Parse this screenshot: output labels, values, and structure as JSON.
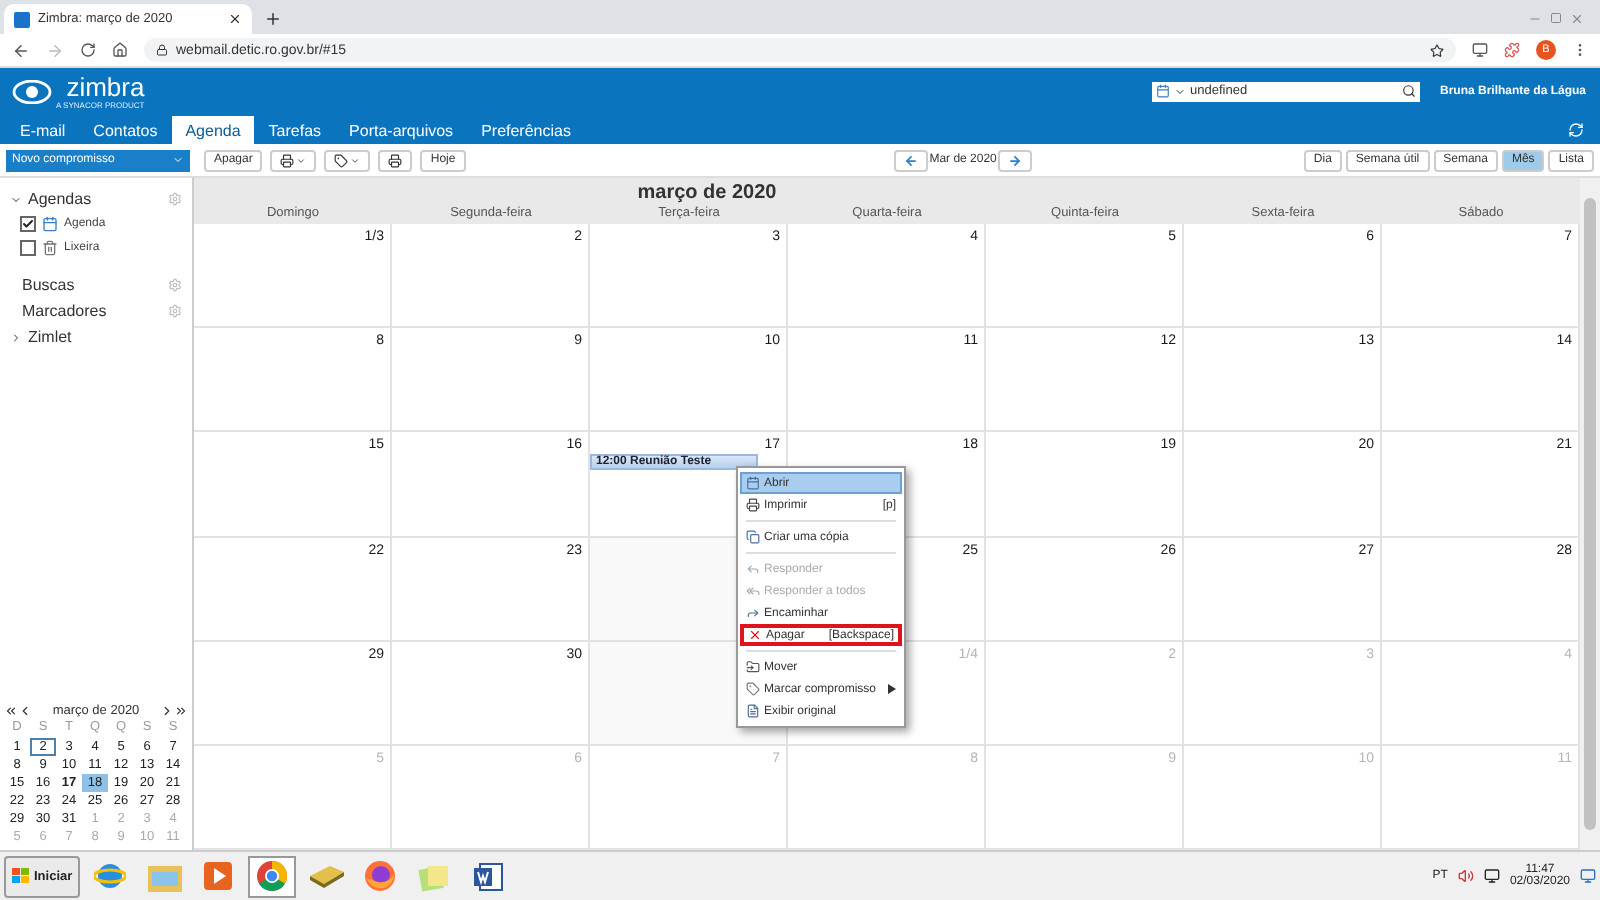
{
  "browser": {
    "tab_title": "Zimbra: março de 2020",
    "url": "webmail.detic.ro.gov.br/#15",
    "avatar": "B"
  },
  "header": {
    "logo": "zimbra",
    "logo_tagline": "A SYNACOR PRODUCT",
    "search": {
      "value": "undefined"
    },
    "user": "Bruna Brilhante da Lágua"
  },
  "tabs": [
    {
      "label": "E-mail",
      "selected": false
    },
    {
      "label": "Contatos",
      "selected": false
    },
    {
      "label": "Agenda",
      "selected": true
    },
    {
      "label": "Tarefas",
      "selected": false
    },
    {
      "label": "Porta-arquivos",
      "selected": false
    },
    {
      "label": "Preferências",
      "selected": false
    }
  ],
  "toolbar": {
    "new": "Novo compromisso",
    "delete": "Apagar",
    "today": "Hoje",
    "period": "Mar de 2020",
    "views": [
      {
        "label": "Dia",
        "selected": false
      },
      {
        "label": "Semana útil",
        "selected": false
      },
      {
        "label": "Semana",
        "selected": false
      },
      {
        "label": "Mês",
        "selected": true
      },
      {
        "label": "Lista",
        "selected": false
      }
    ]
  },
  "sidebar": {
    "agendas": {
      "label": "Agendas",
      "expanded": true,
      "items": [
        {
          "label": "Agenda",
          "checked": true,
          "kind": "calendar"
        },
        {
          "label": "Lixeira",
          "checked": false,
          "kind": "trash"
        }
      ]
    },
    "sections": [
      {
        "label": "Buscas"
      },
      {
        "label": "Marcadores"
      }
    ],
    "zimlet": {
      "label": "Zimlet",
      "expanded": false
    }
  },
  "mini_calendar": {
    "title": "março de 2020",
    "weekdays": [
      "D",
      "S",
      "T",
      "Q",
      "Q",
      "S",
      "S"
    ],
    "weeks": [
      [
        {
          "d": "1",
          "selected": false,
          "today": false,
          "has_events": false,
          "other_month": false
        },
        {
          "d": "2",
          "selected": false,
          "today": true,
          "has_events": false,
          "other_month": false
        },
        {
          "d": "3",
          "selected": false,
          "today": false,
          "has_events": false,
          "other_month": false
        },
        {
          "d": "4",
          "selected": false,
          "today": false,
          "has_events": false,
          "other_month": false
        },
        {
          "d": "5",
          "selected": false,
          "today": false,
          "has_events": false,
          "other_month": false
        },
        {
          "d": "6",
          "selected": false,
          "today": false,
          "has_events": false,
          "other_month": false
        },
        {
          "d": "7",
          "selected": false,
          "today": false,
          "has_events": false,
          "other_month": false
        }
      ],
      [
        {
          "d": "8",
          "selected": false,
          "today": false,
          "has_events": false,
          "other_month": false
        },
        {
          "d": "9",
          "selected": false,
          "today": false,
          "has_events": false,
          "other_month": false
        },
        {
          "d": "10",
          "selected": false,
          "today": false,
          "has_events": false,
          "other_month": false
        },
        {
          "d": "11",
          "selected": false,
          "today": false,
          "has_events": false,
          "other_month": false
        },
        {
          "d": "12",
          "selected": false,
          "today": false,
          "has_events": false,
          "other_month": false
        },
        {
          "d": "13",
          "selected": false,
          "today": false,
          "has_events": false,
          "other_month": false
        },
        {
          "d": "14",
          "selected": false,
          "today": false,
          "has_events": false,
          "other_month": false
        }
      ],
      [
        {
          "d": "15",
          "selected": false,
          "today": false,
          "has_events": false,
          "other_month": false
        },
        {
          "d": "16",
          "selected": false,
          "today": false,
          "has_events": false,
          "other_month": false
        },
        {
          "d": "17",
          "selected": false,
          "today": false,
          "has_events": true,
          "other_month": false
        },
        {
          "d": "18",
          "selected": true,
          "today": false,
          "has_events": false,
          "other_month": false
        },
        {
          "d": "19",
          "selected": false,
          "today": false,
          "has_events": false,
          "other_month": false
        },
        {
          "d": "20",
          "selected": false,
          "today": false,
          "has_events": false,
          "other_month": false
        },
        {
          "d": "21",
          "selected": false,
          "today": false,
          "has_events": false,
          "other_month": false
        }
      ],
      [
        {
          "d": "22",
          "selected": false,
          "today": false,
          "has_events": false,
          "other_month": false
        },
        {
          "d": "23",
          "selected": false,
          "today": false,
          "has_events": false,
          "other_month": false
        },
        {
          "d": "24",
          "selected": false,
          "today": false,
          "has_events": false,
          "other_month": false
        },
        {
          "d": "25",
          "selected": false,
          "today": false,
          "has_events": false,
          "other_month": false
        },
        {
          "d": "26",
          "selected": false,
          "today": false,
          "has_events": false,
          "other_month": false
        },
        {
          "d": "27",
          "selected": false,
          "today": false,
          "has_events": false,
          "other_month": false
        },
        {
          "d": "28",
          "selected": false,
          "today": false,
          "has_events": false,
          "other_month": false
        }
      ],
      [
        {
          "d": "29",
          "selected": false,
          "today": false,
          "has_events": false,
          "other_month": false
        },
        {
          "d": "30",
          "selected": false,
          "today": false,
          "has_events": false,
          "other_month": false
        },
        {
          "d": "31",
          "selected": false,
          "today": false,
          "has_events": false,
          "other_month": false
        },
        {
          "d": "1",
          "selected": false,
          "today": false,
          "has_events": false,
          "other_month": true
        },
        {
          "d": "2",
          "selected": false,
          "today": false,
          "has_events": false,
          "other_month": true
        },
        {
          "d": "3",
          "selected": false,
          "today": false,
          "has_events": false,
          "other_month": true
        },
        {
          "d": "4",
          "selected": false,
          "today": false,
          "has_events": false,
          "other_month": true
        }
      ],
      [
        {
          "d": "5",
          "selected": false,
          "today": false,
          "has_events": false,
          "other_month": true
        },
        {
          "d": "6",
          "selected": false,
          "today": false,
          "has_events": false,
          "other_month": true
        },
        {
          "d": "7",
          "selected": false,
          "today": false,
          "has_events": false,
          "other_month": true
        },
        {
          "d": "8",
          "selected": false,
          "today": false,
          "has_events": false,
          "other_month": true
        },
        {
          "d": "9",
          "selected": false,
          "today": false,
          "has_events": false,
          "other_month": true
        },
        {
          "d": "10",
          "selected": false,
          "today": false,
          "has_events": false,
          "other_month": true
        },
        {
          "d": "11",
          "selected": false,
          "today": false,
          "has_events": false,
          "other_month": true
        }
      ]
    ]
  },
  "calendar": {
    "title": "março de 2020",
    "weekdays": [
      "Domingo",
      "Segunda-feira",
      "Terça-feira",
      "Quarta-feira",
      "Quinta-feira",
      "Sexta-feira",
      "Sábado"
    ],
    "weeks": [
      [
        {
          "day": "1/3",
          "other_month": false
        },
        {
          "day": "2",
          "other_month": false
        },
        {
          "day": "3",
          "other_month": false
        },
        {
          "day": "4",
          "other_month": false
        },
        {
          "day": "5",
          "other_month": false
        },
        {
          "day": "6",
          "other_month": false
        },
        {
          "day": "7",
          "other_month": false
        }
      ],
      [
        {
          "day": "8",
          "other_month": false
        },
        {
          "day": "9",
          "other_month": false
        },
        {
          "day": "10",
          "other_month": false
        },
        {
          "day": "11",
          "other_month": false
        },
        {
          "day": "12",
          "other_month": false
        },
        {
          "day": "13",
          "other_month": false
        },
        {
          "day": "14",
          "other_month": false
        }
      ],
      [
        {
          "day": "15",
          "other_month": false
        },
        {
          "day": "16",
          "other_month": false
        },
        {
          "day": "17",
          "other_month": false,
          "events": [
            {
              "label": "12:00 Reunião Teste"
            }
          ]
        },
        {
          "day": "18",
          "other_month": false
        },
        {
          "day": "19",
          "other_month": false
        },
        {
          "day": "20",
          "other_month": false
        },
        {
          "day": "21",
          "other_month": false
        }
      ],
      [
        {
          "day": "22",
          "other_month": false
        },
        {
          "day": "23",
          "other_month": false
        },
        {
          "kind": "covered"
        },
        {
          "day": "25",
          "other_month": false
        },
        {
          "day": "26",
          "other_month": false
        },
        {
          "day": "27",
          "other_month": false
        },
        {
          "day": "28",
          "other_month": false
        }
      ],
      [
        {
          "day": "29",
          "other_month": false
        },
        {
          "day": "30",
          "other_month": false
        },
        {
          "kind": "covered"
        },
        {
          "day": "1/4",
          "other_month": true
        },
        {
          "day": "2",
          "other_month": true
        },
        {
          "day": "3",
          "other_month": true
        },
        {
          "day": "4",
          "other_month": true
        }
      ],
      [
        {
          "day": "5",
          "other_month": true
        },
        {
          "day": "6",
          "other_month": true
        },
        {
          "day": "7",
          "other_month": true
        },
        {
          "day": "8",
          "other_month": true
        },
        {
          "day": "9",
          "other_month": true
        },
        {
          "day": "10",
          "other_month": true
        },
        {
          "day": "11",
          "other_month": true
        }
      ]
    ]
  },
  "context_menu": [
    {
      "kind": "open",
      "label": "Abrir",
      "selected": true,
      "disabled": false,
      "outlined": false
    },
    {
      "kind": "print",
      "label": "Imprimir",
      "shortcut": "[p]",
      "selected": false,
      "disabled": false,
      "outlined": false
    },
    {
      "kind": "separator"
    },
    {
      "kind": "copy",
      "label": "Criar uma cópia",
      "selected": false,
      "disabled": false,
      "outlined": false
    },
    {
      "kind": "separator"
    },
    {
      "kind": "reply",
      "label": "Responder",
      "selected": false,
      "disabled": true,
      "outlined": false
    },
    {
      "kind": "reply-all",
      "label": "Responder a todos",
      "selected": false,
      "disabled": true,
      "outlined": false
    },
    {
      "kind": "forward",
      "label": "Encaminhar",
      "selected": false,
      "disabled": false,
      "outlined": false
    },
    {
      "kind": "delete",
      "label": "Apagar",
      "shortcut": "[Backspace]",
      "selected": false,
      "disabled": false,
      "outlined": true
    },
    {
      "kind": "separator"
    },
    {
      "kind": "move",
      "label": "Mover",
      "selected": false,
      "disabled": false,
      "outlined": false
    },
    {
      "kind": "tag",
      "label": "Marcar compromisso",
      "submenu": true,
      "selected": false,
      "disabled": false,
      "outlined": false
    },
    {
      "kind": "source",
      "label": "Exibir original",
      "selected": false,
      "disabled": false,
      "outlined": false
    }
  ],
  "taskbar": {
    "start": "Iniciar",
    "apps": [
      {
        "kind": "ie",
        "selected": false
      },
      {
        "kind": "folder",
        "selected": false
      },
      {
        "kind": "media",
        "selected": false
      },
      {
        "kind": "chrome",
        "selected": true
      },
      {
        "kind": "stack",
        "selected": false
      },
      {
        "kind": "firefox",
        "selected": false
      },
      {
        "kind": "notes",
        "selected": false
      },
      {
        "kind": "word",
        "selected": false
      }
    ],
    "lang": "PT",
    "time": "11:47",
    "date": "02/03/2020"
  }
}
